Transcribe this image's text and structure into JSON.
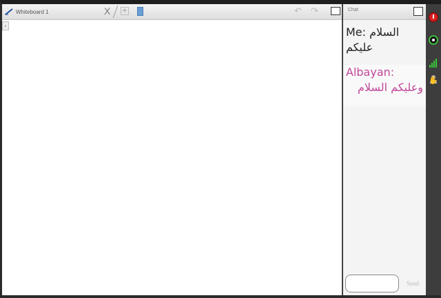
{
  "whiteboard": {
    "tab_label": "Whiteboard 1",
    "close_glyph": "X",
    "add_glyph": "+",
    "expander_glyph": "›",
    "undo_glyph": "↶",
    "redo_glyph": "↷"
  },
  "chat": {
    "title": "Chat",
    "messages": [
      {
        "lines": [
          "Me: السلام",
          "عليكم"
        ],
        "color": "#222222"
      },
      {
        "lines": [
          "Albayan:",
          "وعليكم السلام"
        ],
        "color": "#c0479a"
      }
    ],
    "input_value": "",
    "send_label": "Send"
  },
  "toolbar": {
    "icons": [
      "power-icon",
      "record-icon",
      "signal-icon",
      "user-icon",
      "hand-icon"
    ],
    "hand_glyph": "✋"
  },
  "colors": {
    "toolbar_bg": "#3d3d3d",
    "power": "#d42020",
    "signal": "#38c838",
    "other_message": "#c0479a"
  }
}
